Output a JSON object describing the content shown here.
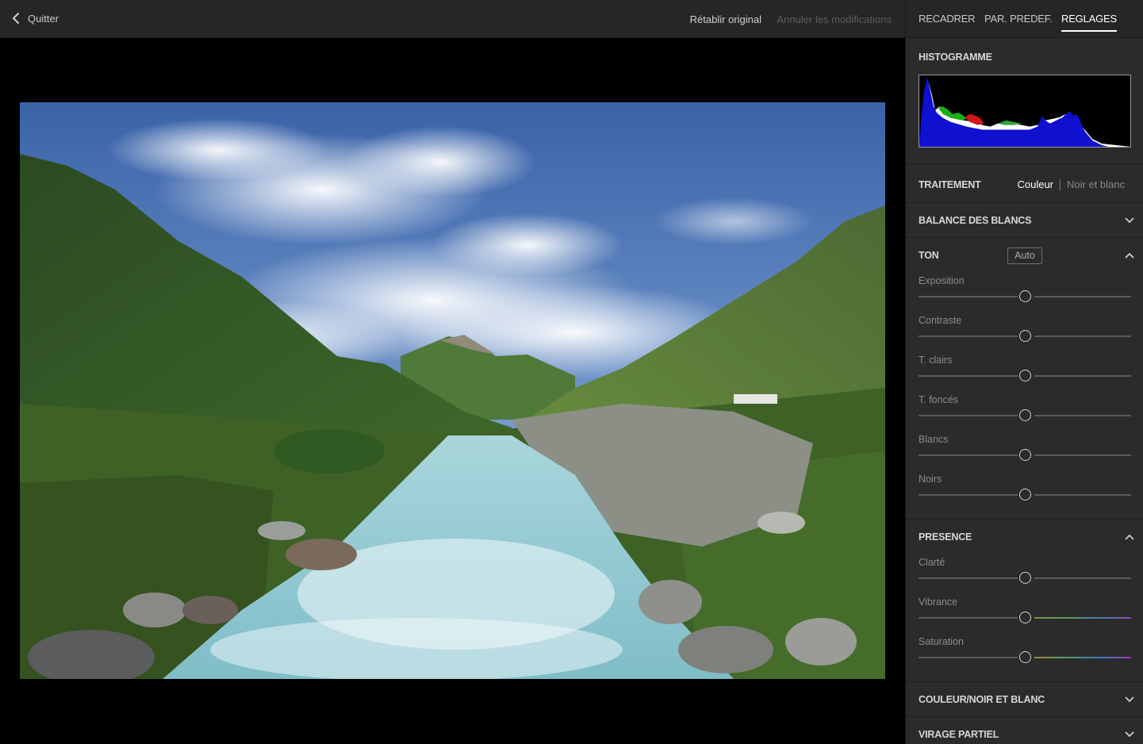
{
  "topbar": {
    "quit_label": "Quitter",
    "restore_label": "Rétablir original",
    "undo_label": "Annuler les modifications"
  },
  "tabs": [
    {
      "label": "RECADRER",
      "active": false
    },
    {
      "label": "PAR. PREDEF.",
      "active": false
    },
    {
      "label": "REGLAGES",
      "active": true
    }
  ],
  "histogram": {
    "title": "HISTOGRAMME"
  },
  "treatment": {
    "title": "TRAITEMENT",
    "color_label": "Couleur",
    "bw_label": "Noir et blanc",
    "selected": "Couleur"
  },
  "white_balance": {
    "title": "BALANCE DES BLANCS",
    "expanded": false
  },
  "tone": {
    "title": "TON",
    "auto_label": "Auto",
    "expanded": true,
    "sliders": [
      {
        "label": "Exposition",
        "value": 0
      },
      {
        "label": "Contraste",
        "value": 0
      },
      {
        "label": "T. clairs",
        "value": 0
      },
      {
        "label": "T. foncés",
        "value": 0
      },
      {
        "label": "Blancs",
        "value": 0
      },
      {
        "label": "Noirs",
        "value": 0
      }
    ]
  },
  "presence": {
    "title": "PRESENCE",
    "expanded": true,
    "sliders": [
      {
        "label": "Clarté",
        "value": 0
      },
      {
        "label": "Vibrance",
        "value": 0
      },
      {
        "label": "Saturation",
        "value": 0
      }
    ]
  },
  "color_bw": {
    "title": "COULEUR/NOIR ET BLANC",
    "expanded": false
  },
  "split_tone": {
    "title": "VIRAGE PARTIEL",
    "expanded": false
  },
  "icons": {
    "back": "chevron-left-icon",
    "collapse": "chevron-down-icon",
    "expand": "chevron-up-icon"
  },
  "colors": {
    "panel_bg": "#2b2b2b",
    "topbar_bg": "#262626",
    "canvas_bg": "#000000",
    "active_text": "#ffffff",
    "muted_text": "#8c8c8c"
  }
}
